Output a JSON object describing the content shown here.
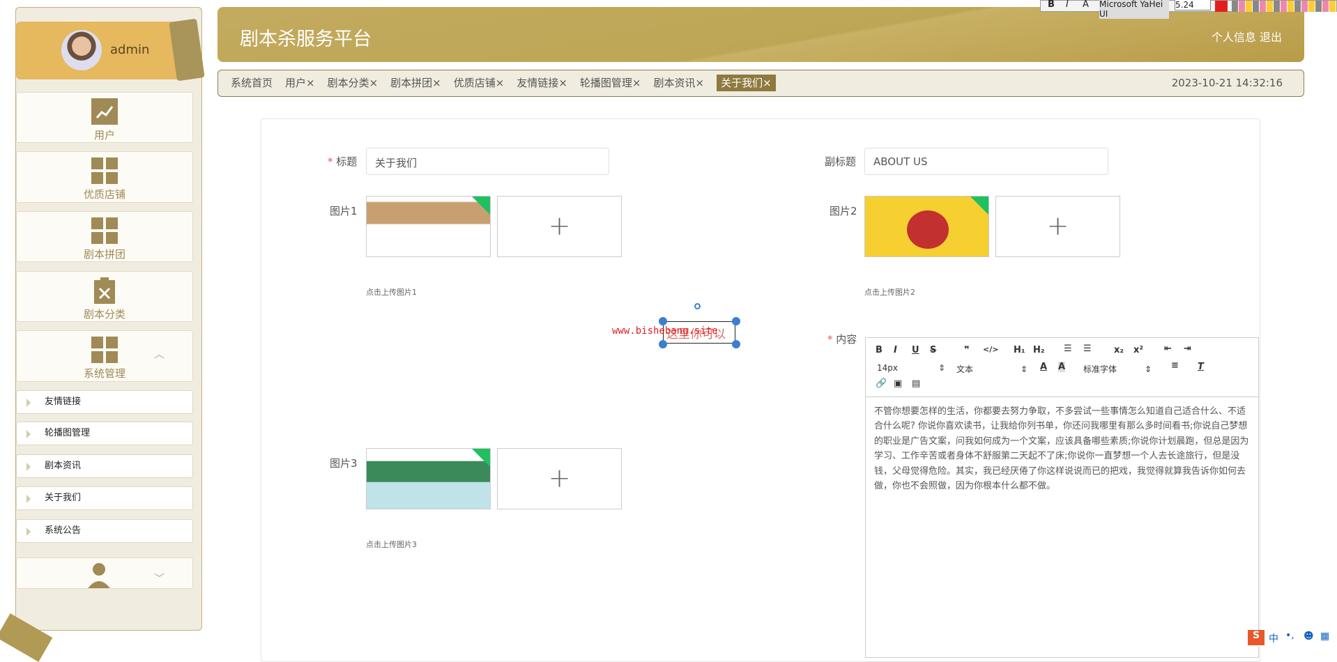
{
  "user": {
    "name": "admin"
  },
  "sidebar": {
    "menus": [
      {
        "label": "用户",
        "icon": "chart-icon"
      },
      {
        "label": "优质店铺",
        "icon": "grid-icon"
      },
      {
        "label": "剧本拼团",
        "icon": "grid-icon"
      },
      {
        "label": "剧本分类",
        "icon": "clipboard-x-icon"
      },
      {
        "label": "系统管理",
        "icon": "grid-icon"
      }
    ],
    "subitems": [
      "友情链接",
      "轮播图管理",
      "剧本资讯",
      "关于我们",
      "系统公告"
    ]
  },
  "header": {
    "title": "剧本杀服务平台",
    "profile": "个人信息",
    "logout": "退出"
  },
  "tabs": [
    "系统首页",
    "用户×",
    "剧本分类×",
    "剧本拼团×",
    "优质店铺×",
    "友情链接×",
    "轮播图管理×",
    "剧本资讯×",
    "关于我们×"
  ],
  "clock": "2023-10-21 14:32:16",
  "form": {
    "title_label": "标题",
    "title_value": "关于我们",
    "subtitle_label": "副标题",
    "subtitle_value": "ABOUT US",
    "pic1_label": "图片1",
    "pic1_hint": "点击上传图片1",
    "pic2_label": "图片2",
    "pic2_hint": "点击上传图片2",
    "pic3_label": "图片3",
    "pic3_hint": "点击上传图片3",
    "content_label": "内容"
  },
  "editor": {
    "font_size": "14px",
    "header": "文本",
    "font": "标准字体",
    "content": "不管你想要怎样的生活，你都要去努力争取，不多尝试一些事情怎么知道自己适合什么、不适合什么呢? 你说你喜欢读书，让我给你列书单，你还问我哪里有那么多时间看书;你说自己梦想的职业是广告文案，问我如何成为一个文案，应该具备哪些素质;你说你计划晨跑，但总是因为学习、工作辛苦或者身体不舒服第二天起不了床;你说你一直梦想一个人去长途旅行，但是没钱，父母觉得危险。其实，我已经厌倦了你这样说说而已的把戏，我觉得就算我告诉你如何去做，你也不会照做，因为你根本什么都不做。"
  },
  "annotation": {
    "watermark": "www.bishebang.site",
    "text": "这里你可以"
  },
  "float_toolbar": {
    "font": "Microsoft YaHei UI",
    "size": "5.24",
    "color": "#e02020"
  },
  "ime": {
    "mode": "中"
  },
  "colors": {
    "accent": "#8e7a3e",
    "header": "#c0a85a",
    "sidebar": "#f1ece0"
  }
}
